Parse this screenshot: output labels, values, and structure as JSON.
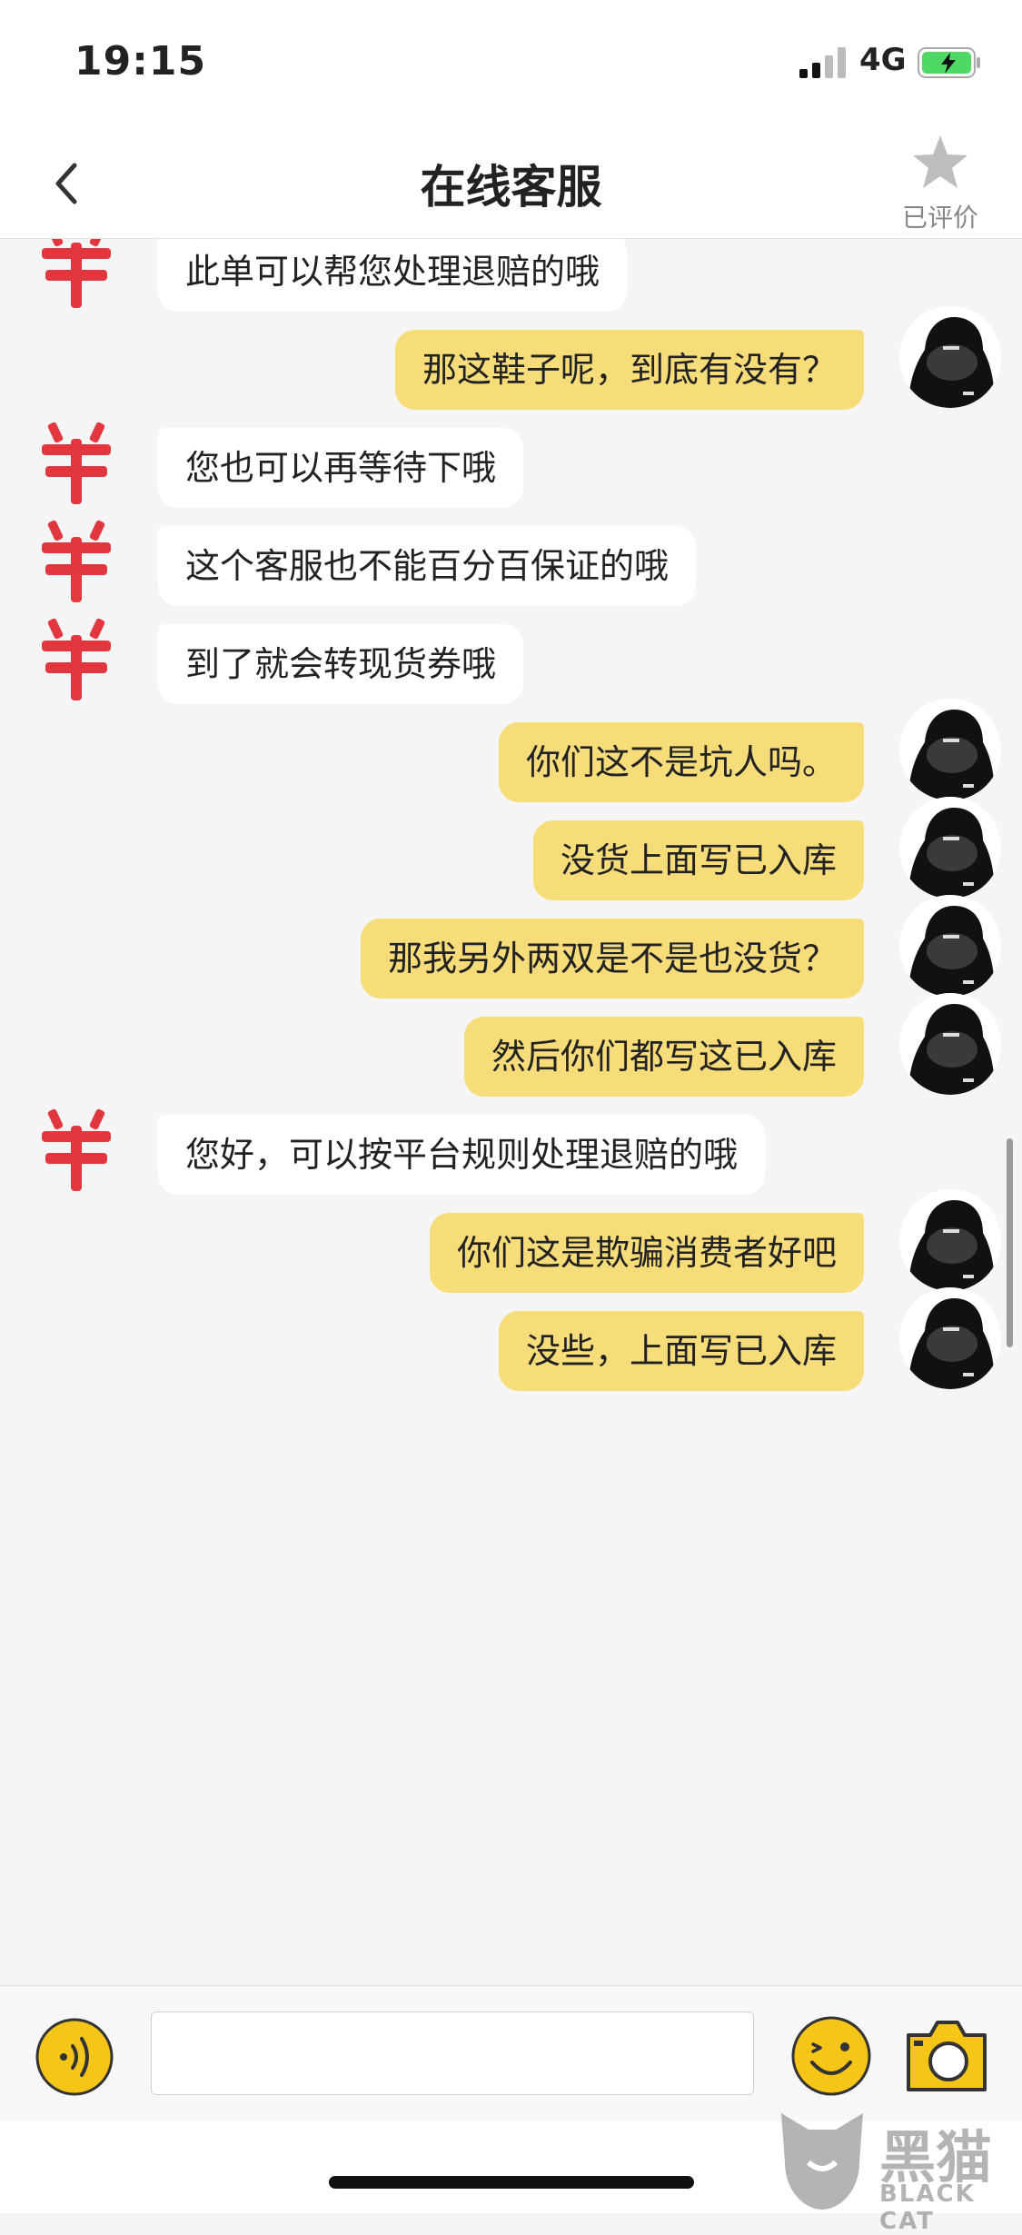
{
  "status_bar": {
    "time": "19:15",
    "network": "4G"
  },
  "header": {
    "title": "在线客服",
    "rate_label": "已评价"
  },
  "messages": [
    {
      "side": "in",
      "text": "此单可以帮您处理退赔的哦"
    },
    {
      "side": "out",
      "text": "那这鞋子呢，到底有没有？"
    },
    {
      "side": "in",
      "text": "您也可以再等待下哦"
    },
    {
      "side": "in",
      "text": "这个客服也不能百分百保证的哦"
    },
    {
      "side": "in",
      "text": "到了就会转现货券哦"
    },
    {
      "side": "out",
      "text": "你们这不是坑人吗。"
    },
    {
      "side": "out",
      "text": "没货上面写已入库"
    },
    {
      "side": "out",
      "text": "那我另外两双是不是也没货？"
    },
    {
      "side": "out",
      "text": "然后你们都写这已入库"
    },
    {
      "side": "in",
      "text": "您好，可以按平台规则处理退赔的哦"
    },
    {
      "side": "out",
      "text": "你们这是欺骗消费者好吧"
    },
    {
      "side": "out",
      "text": "没些，上面写已入库"
    }
  ],
  "input": {
    "value": "",
    "placeholder": ""
  },
  "icons": {
    "voice": "voice-icon",
    "emoji": "emoji-icon",
    "camera": "camera-icon",
    "back": "chevron-left-icon",
    "star": "star-icon"
  },
  "colors": {
    "accent": "#f5c518",
    "outgoing_bubble": "#f7dc7a",
    "incoming_bubble": "#ffffff",
    "agent_avatar": "#e0232b"
  },
  "watermark": {
    "brand": "黑猫",
    "sub": "BLACK CAT"
  }
}
